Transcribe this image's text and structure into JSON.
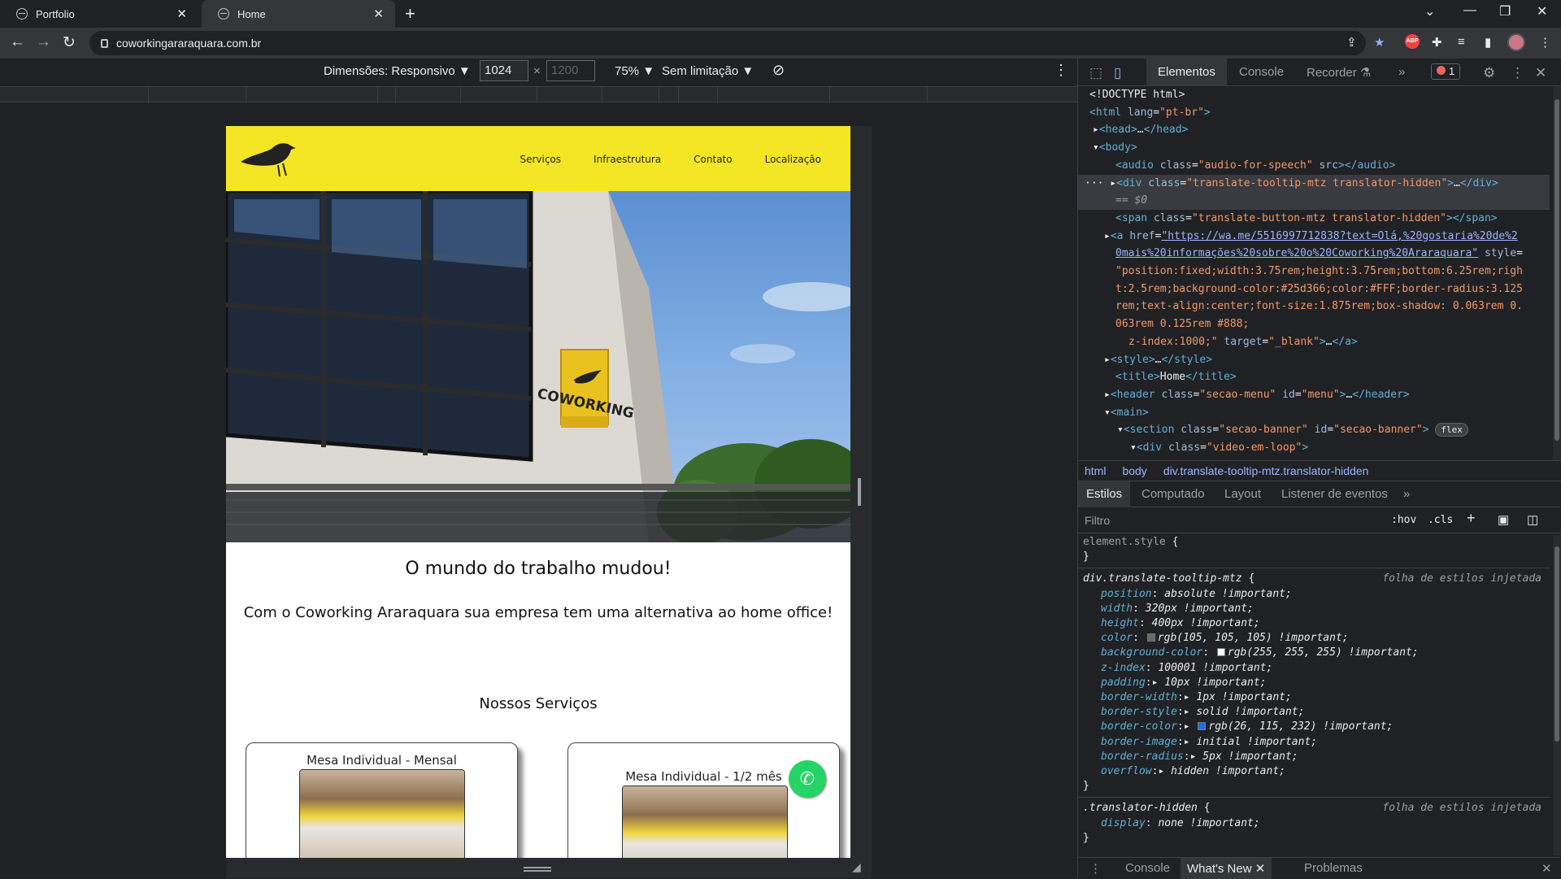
{
  "browser": {
    "tabs": [
      {
        "label": "Portfolio",
        "active": false
      },
      {
        "label": "Home",
        "active": true
      }
    ],
    "url": "coworkingararaquara.com.br"
  },
  "device_toolbar": {
    "dimensions_label": "Dimensões: Responsivo ▼",
    "width": "1024",
    "height_placeholder": "1200",
    "zoom": "75% ▼",
    "throttle": "Sem limitação ▼"
  },
  "site": {
    "menu": [
      "Serviços",
      "Infraestrutura",
      "Contato",
      "Localização"
    ],
    "heading": "O mundo do trabalho mudou!",
    "subheading": "Com o Coworking Araraquara sua empresa tem uma alternativa ao home office!",
    "services_title": "Nossos Serviços",
    "cards": [
      {
        "title": "Mesa Individual - Mensal"
      },
      {
        "title": "Mesa Individual - 1/2 mês"
      }
    ],
    "sign_text": "COWORKING"
  },
  "devtools": {
    "tabs": [
      "Elementos",
      "Console",
      "Recorder ⚗",
      "»"
    ],
    "error_count": "1",
    "breadcrumb": [
      "html",
      "body",
      "div.translate-tooltip-mtz.translator-hidden"
    ],
    "styles_tabs": [
      "Estilos",
      "Computado",
      "Layout",
      "Listener de eventos",
      "»"
    ],
    "filter_placeholder": "Filtro",
    "hov": ":hov",
    "cls": ".cls",
    "drawer_tabs": [
      "Console",
      "What's New",
      "Problemas"
    ],
    "colors": {
      "accent": "#f5e625",
      "whatsapp": "#25d366",
      "gray": "#696969",
      "white": "#ffffff",
      "blue": "#1a73e8"
    }
  }
}
